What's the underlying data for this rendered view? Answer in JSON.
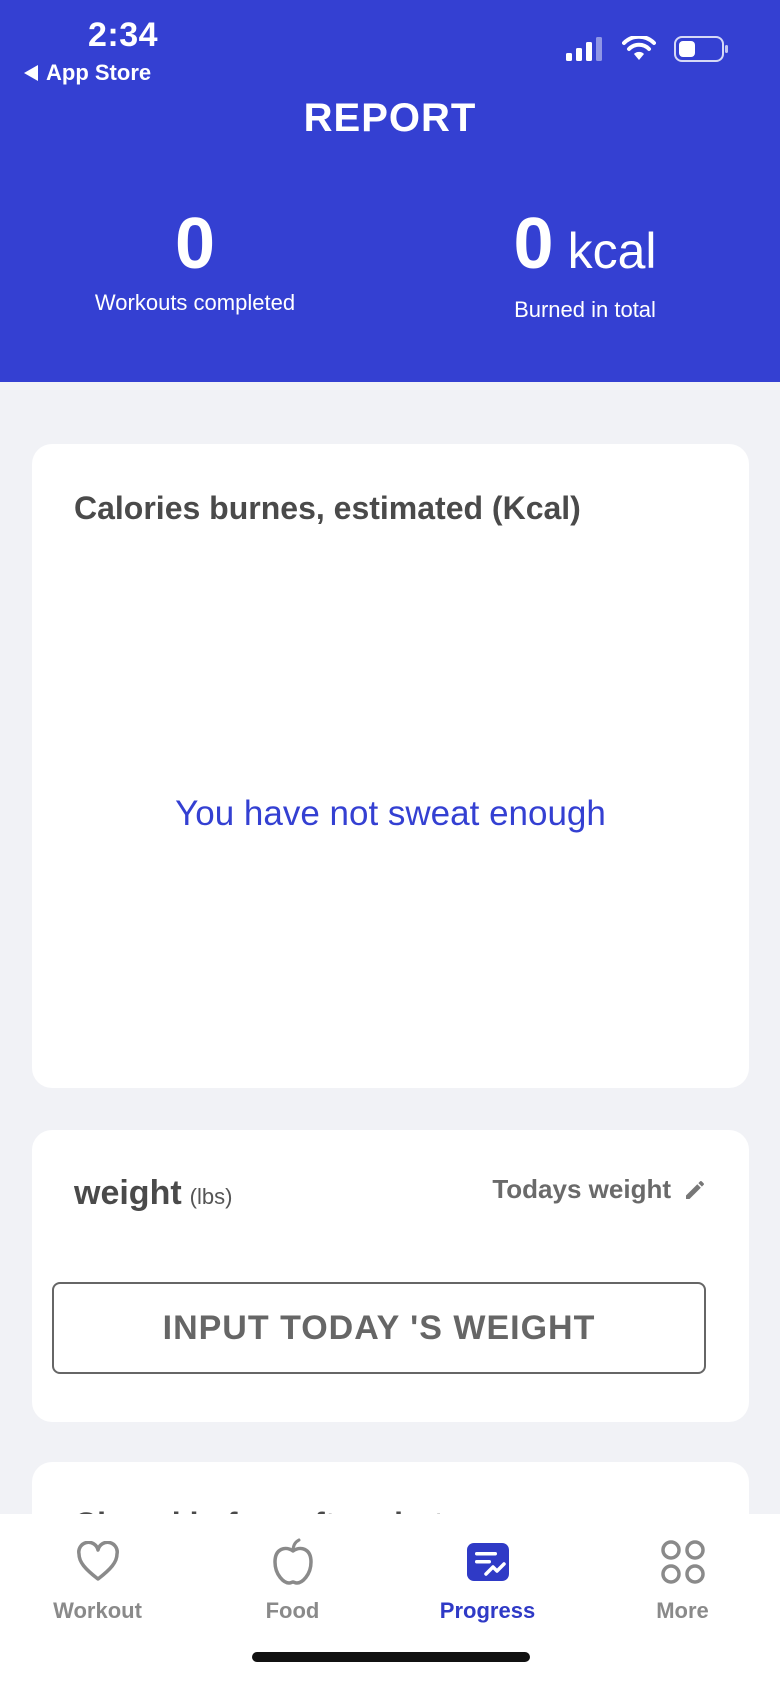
{
  "status_bar": {
    "time": "2:34",
    "back_label": "App Store"
  },
  "header": {
    "title": "REPORT",
    "stats": [
      {
        "value": "0",
        "unit": "",
        "label": "Workouts completed"
      },
      {
        "value": "0",
        "unit": "kcal",
        "label": "Burned in total"
      }
    ]
  },
  "calories_card": {
    "title": "Calories burnes, estimated (Kcal)",
    "empty_message": "You have not sweat enough"
  },
  "weight_card": {
    "title": "weight",
    "unit": "(lbs)",
    "todays_label": "Todays weight",
    "input_button": "INPUT TODAY 'S WEIGHT"
  },
  "next_card": {
    "title": "Chapel before after photo"
  },
  "tabbar": {
    "tabs": [
      {
        "label": "Workout",
        "icon": "heart-icon"
      },
      {
        "label": "Food",
        "icon": "apple-icon"
      },
      {
        "label": "Progress",
        "icon": "progress-icon"
      },
      {
        "label": "More",
        "icon": "grid-icon"
      }
    ],
    "active_index": 2
  },
  "colors": {
    "brand": "#3440d2",
    "active_tab": "#2f3ac6"
  }
}
